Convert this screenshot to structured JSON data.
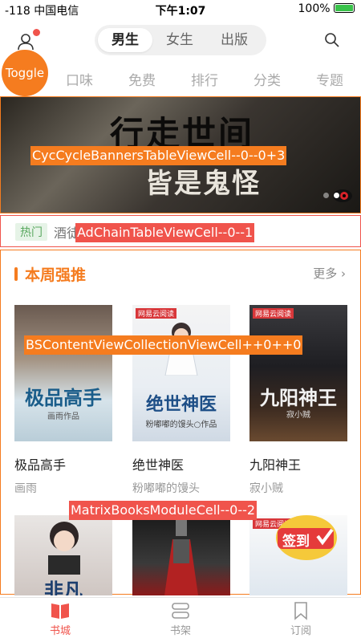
{
  "status_bar": {
    "carrier": "-118 中国电信",
    "time": "下午1:07",
    "battery": "100%"
  },
  "header": {
    "segments": [
      "男生",
      "女生",
      "出版"
    ],
    "active_segment": "男生",
    "toggle_label": "Toggle"
  },
  "categories": [
    "口味",
    "免费",
    "排行",
    "分类",
    "专题"
  ],
  "banner": {
    "title_line1": "行走世间",
    "title_line2": "皆是鬼怪",
    "debug_label": "CycCycleBannersTableViewCell--0--0+3"
  },
  "ad_chain": {
    "hot_tag": "热门",
    "text": "酒徒",
    "debug_label": "AdChainTableViewCell--0--1"
  },
  "module": {
    "title": "本周强推",
    "more_label": "更多",
    "collection_debug_label": "BSContentViewCollectionViewCell++0++0",
    "matrix_debug_label": "MatrixBooksModuleCell--0--2",
    "books": [
      {
        "name": "极品高手",
        "author": "画雨",
        "cover_title": "极品高手",
        "cover_sub": "画雨作品"
      },
      {
        "name": "绝世神医",
        "author": "粉嘟嘟的馒头",
        "cover_title": "绝世神医",
        "cover_sub": "粉嘟嘟的馒头○作品",
        "publisher": "网易云阅读"
      },
      {
        "name": "九阳神王",
        "author": "寂小贼",
        "cover_title": "九阳神王",
        "cover_sub": "寂小贼",
        "publisher": "网易云阅读"
      }
    ],
    "row2_cover_text": "非凡",
    "row2_publisher": "网易云阅读",
    "signin_label": "签到"
  },
  "tabbar": {
    "items": [
      {
        "label": "书城",
        "active": true
      },
      {
        "label": "书架",
        "active": false
      },
      {
        "label": "订阅",
        "active": false
      }
    ]
  },
  "colors": {
    "accent": "#f57c1f",
    "active_tab": "#f0544c",
    "debug_orange": "#f57c1f",
    "debug_red": "#f0544c"
  }
}
